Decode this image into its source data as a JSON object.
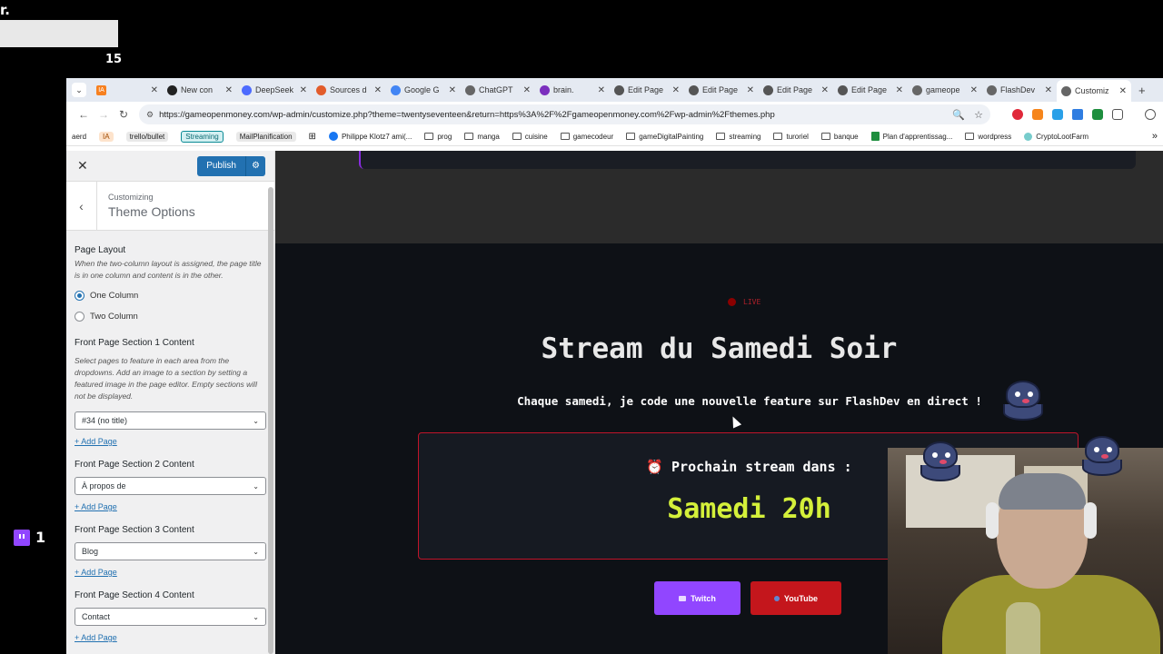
{
  "overlay": {
    "corner_text": "r.",
    "top_number": "15",
    "twitch_count": "1"
  },
  "browser": {
    "tabs": [
      {
        "title": "",
        "icon": "ia-icon",
        "badge": "IA"
      },
      {
        "title": "New con",
        "icon": "openai-icon"
      },
      {
        "title": "DeepSeek",
        "icon": "deepseek-icon"
      },
      {
        "title": "Sources d",
        "icon": "sources-icon"
      },
      {
        "title": "Google G",
        "icon": "gemini-icon"
      },
      {
        "title": "ChatGPT",
        "icon": "chatgpt-icon"
      },
      {
        "title": "brain.",
        "icon": "brain-icon"
      },
      {
        "title": "Edit Page",
        "icon": "wordpress-icon"
      },
      {
        "title": "Edit Page",
        "icon": "wordpress-icon"
      },
      {
        "title": "Edit Page",
        "icon": "wordpress-icon"
      },
      {
        "title": "Edit Page",
        "icon": "wordpress-icon"
      },
      {
        "title": "gameope",
        "icon": "globe-icon"
      },
      {
        "title": "FlashDev",
        "icon": "globe-icon"
      },
      {
        "title": "Customiz",
        "icon": "globe-icon",
        "active": true
      }
    ],
    "url": "https://gameopenmoney.com/wp-admin/customize.php?theme=twentyseventeen&return=https%3A%2F%2Fgameopenmoney.com%2Fwp-admin%2Fthemes.php",
    "bookmarks": [
      {
        "label": "aerd",
        "type": "text"
      },
      {
        "label": "IA",
        "type": "pill-orange"
      },
      {
        "label": "trello/bullet",
        "type": "pill-gray"
      },
      {
        "label": "Streaming",
        "type": "pill-teal"
      },
      {
        "label": "MailPlanification",
        "type": "pill-gray"
      },
      {
        "label": "Philippe Klotz7 ami(...",
        "type": "facebook"
      },
      {
        "label": "prog",
        "type": "folder"
      },
      {
        "label": "manga",
        "type": "folder"
      },
      {
        "label": "cuisine",
        "type": "folder"
      },
      {
        "label": "gamecodeur",
        "type": "folder"
      },
      {
        "label": "gameDigitalPainting",
        "type": "folder"
      },
      {
        "label": "streaming",
        "type": "folder"
      },
      {
        "label": "turoriel",
        "type": "folder"
      },
      {
        "label": "banque",
        "type": "folder"
      },
      {
        "label": "Plan d'apprentissag...",
        "type": "sheet"
      },
      {
        "label": "wordpress",
        "type": "folder"
      },
      {
        "label": "CryptoLootFarm",
        "type": "link"
      }
    ]
  },
  "customizer": {
    "publish_label": "Publish",
    "breadcrumb": "Customizing",
    "section_title": "Theme Options",
    "page_layout": {
      "label": "Page Layout",
      "description": "When the two-column layout is assigned, the page title is in one column and content is in the other.",
      "options": [
        {
          "label": "One Column",
          "checked": true
        },
        {
          "label": "Two Column",
          "checked": false
        }
      ]
    },
    "sections": [
      {
        "label": "Front Page Section 1 Content",
        "description": "Select pages to feature in each area from the dropdowns. Add an image to a section by setting a featured image in the page editor. Empty sections will not be displayed.",
        "value": "#34 (no title)",
        "add_label": "+ Add Page"
      },
      {
        "label": "Front Page Section 2 Content",
        "description": "",
        "value": "À propos de",
        "add_label": "+ Add Page"
      },
      {
        "label": "Front Page Section 3 Content",
        "description": "",
        "value": "Blog",
        "add_label": "+ Add Page"
      },
      {
        "label": "Front Page Section 4 Content",
        "description": "",
        "value": "Contact",
        "add_label": "+ Add Page"
      }
    ]
  },
  "preview": {
    "live_label": "LIVE",
    "title": "Stream du Samedi Soir",
    "subtitle": "Chaque samedi, je code une nouvelle feature sur FlashDev en direct !",
    "countdown_label": "⏰ Prochain stream dans :",
    "countdown_time": "Samedi 20h",
    "twitch_label": "Twitch",
    "youtube_label": "YouTube"
  },
  "colors": {
    "wp_blue": "#2271b1",
    "twitch_purple": "#9146ff",
    "youtube_red": "#c4161c",
    "countdown_green": "#d4f03a",
    "accent_red": "#c0142a"
  }
}
